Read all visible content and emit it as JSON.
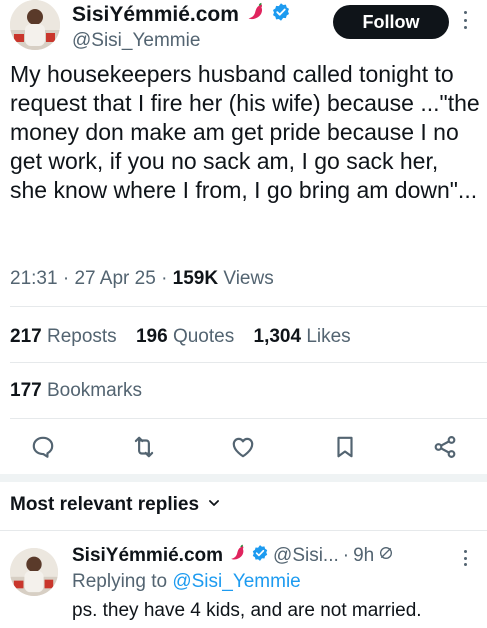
{
  "author": {
    "display_name": "SisiYémmié.com",
    "handle": "@Sisi_Yemmie",
    "badge_icon": "chili-pepper-icon",
    "verified_icon": "verified-badge-icon"
  },
  "header": {
    "follow_label": "Follow"
  },
  "tweet": {
    "text": "My housekeepers husband called tonight to request that I fire her (his wife) because ...\"the money don make am get pride because I no get work, if you no sack am, I go sack her, she know where I from, I go bring am down\"...",
    "time": "21:31",
    "date": "27 Apr 25",
    "views_count": "159K",
    "views_label": "Views"
  },
  "stats": {
    "reposts_count": "217",
    "reposts_label": "Reposts",
    "quotes_count": "196",
    "quotes_label": "Quotes",
    "likes_count": "1,304",
    "likes_label": "Likes",
    "bookmarks_count": "177",
    "bookmarks_label": "Bookmarks"
  },
  "actions": [
    "reply-icon",
    "repost-icon",
    "like-icon",
    "bookmark-icon",
    "share-icon"
  ],
  "replies": {
    "sort_label": "Most relevant replies",
    "items": [
      {
        "display_name": "SisiYémmié.com",
        "handle_short": "@Sisi...",
        "time": "9h",
        "replying_prefix": "Replying to",
        "replying_to": "@Sisi_Yemmie",
        "text": "ps. they have 4 kids, and are not married."
      }
    ]
  },
  "colors": {
    "text_primary": "#0f1419",
    "text_secondary": "#536471",
    "accent_blue": "#1d9bf0",
    "chili_red": "#e0245e"
  }
}
